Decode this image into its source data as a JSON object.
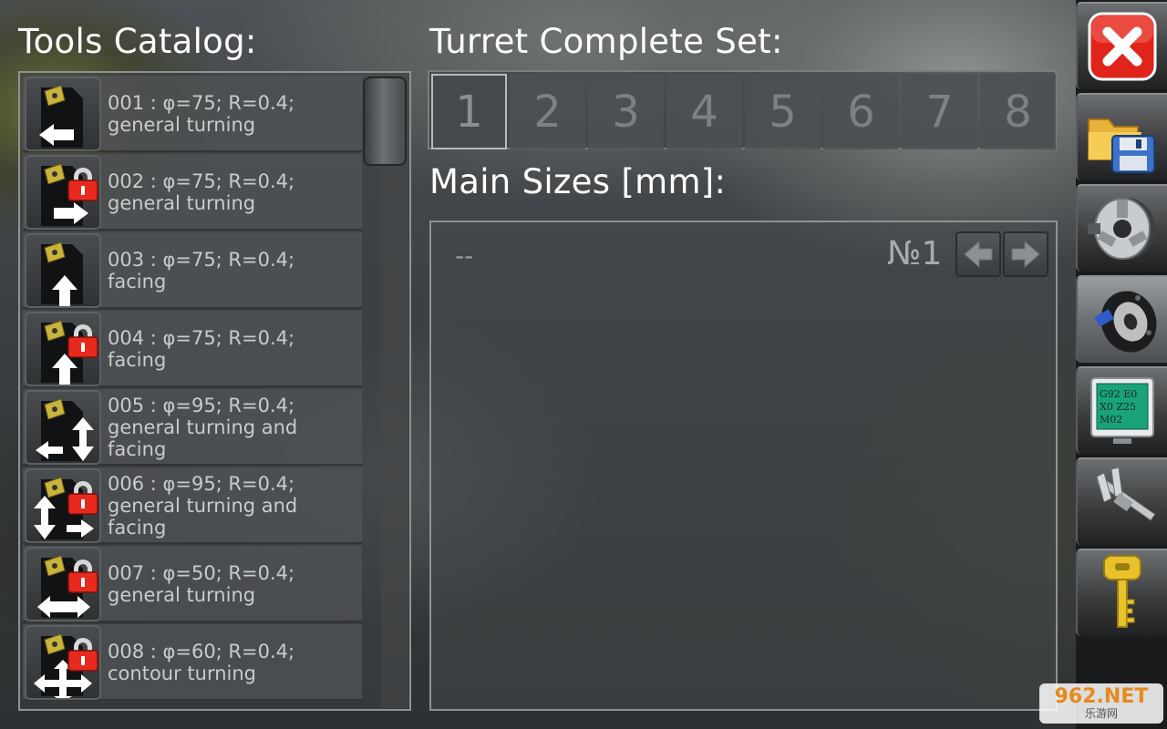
{
  "catalog": {
    "title": "Tools Catalog:",
    "items": [
      {
        "label": "001 : φ=75; R=0.4; general turning",
        "locked": false,
        "icon": "tool-arrow-left-icon"
      },
      {
        "label": "002 : φ=75; R=0.4; general turning",
        "locked": true,
        "icon": "tool-arrow-right-icon"
      },
      {
        "label": "003 : φ=75; R=0.4; facing",
        "locked": false,
        "icon": "tool-arrow-up-icon"
      },
      {
        "label": "004 : φ=75; R=0.4; facing",
        "locked": true,
        "icon": "tool-arrow-up-icon"
      },
      {
        "label": "005 : φ=95; R=0.4; general turning and facing",
        "locked": false,
        "icon": "tool-arrow-left-updown-icon"
      },
      {
        "label": "006 : φ=95; R=0.4; general turning and facing",
        "locked": true,
        "icon": "tool-arrow-right-updown-icon"
      },
      {
        "label": "007 : φ=50; R=0.4; general turning",
        "locked": true,
        "icon": "tool-arrow-leftright-icon"
      },
      {
        "label": "008 : φ=60; R=0.4; contour turning",
        "locked": true,
        "icon": "tool-arrow-cross-icon"
      }
    ]
  },
  "turret": {
    "title": "Turret Complete Set:",
    "tabs": [
      "1",
      "2",
      "3",
      "4",
      "5",
      "6",
      "7",
      "8"
    ],
    "active_tab": "1"
  },
  "sizes": {
    "title": "Main Sizes [mm]:",
    "value": "--",
    "position_label": "№1"
  },
  "toolbar": {
    "items": [
      "close-icon",
      "save-folder-icon",
      "lathe-chuck-icon",
      "turret-disk-icon",
      "gcode-monitor-icon",
      "caliper-icon",
      "key-icon"
    ],
    "gcode_text": [
      "G92 E0",
      "X0 Z25",
      "M02"
    ],
    "selected": "turret-disk-icon"
  },
  "watermark": {
    "top": "962.NET",
    "bottom": "乐游网"
  },
  "colors": {
    "close_red": "#e0241c",
    "lock_red": "#e82a1e",
    "insert_yellow": "#c9b33a",
    "key_gold": "#e8c22a",
    "monitor_green": "#1aa37a"
  }
}
